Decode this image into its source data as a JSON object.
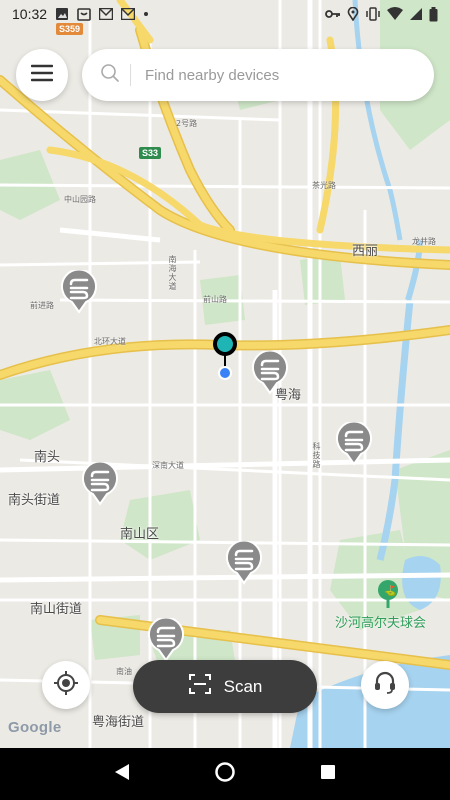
{
  "status_bar": {
    "time": "10:32",
    "left_icons": [
      "image-icon",
      "clipboard-icon",
      "gmail-icon",
      "gmail-icon",
      "dot-icon"
    ],
    "right_icons": [
      "key-icon",
      "location-icon",
      "vibrate-icon",
      "wifi-icon",
      "signal-icon",
      "battery-icon"
    ]
  },
  "search": {
    "placeholder": "Find nearby devices",
    "value": ""
  },
  "map": {
    "road_shields": {
      "s359": "S359",
      "s33": "S33"
    },
    "labels": {
      "xili": "西丽",
      "yuehai": "粤海",
      "nantou": "南头",
      "nantou_street": "南头街道",
      "nanshan_district": "南山区",
      "nanshan_street": "南山街道",
      "shahe_golf": "沙河高尔夫球会",
      "nanshan_avenue": "南海大道",
      "ring_avenue": "北环大道",
      "shennan_avenue": "深南大道",
      "chaguang_road": "茶光路",
      "longjing_road": "龙井路",
      "zhongshan_road": "中山园路",
      "qianjin_road": "前进路",
      "qianshan_road": "前山路",
      "kejiro_road": "科技路",
      "road_2": "2号路",
      "yuehai_street": "粤海街道",
      "nanyou": "南油"
    },
    "device_count": 7
  },
  "actions": {
    "scan_label": "Scan"
  },
  "attribution": {
    "google": "Google"
  },
  "colors": {
    "map_bg": "#eceae4",
    "highway": "#f6d86b",
    "highway_edge": "#e6c04a",
    "water": "#a6d3f0",
    "park": "#cfe6c8",
    "pin_gray": "#8a8a8a",
    "selected_pin": "#1fb5b5",
    "user_dot": "#3b82f6",
    "scan_bg": "#3d3d3d"
  }
}
